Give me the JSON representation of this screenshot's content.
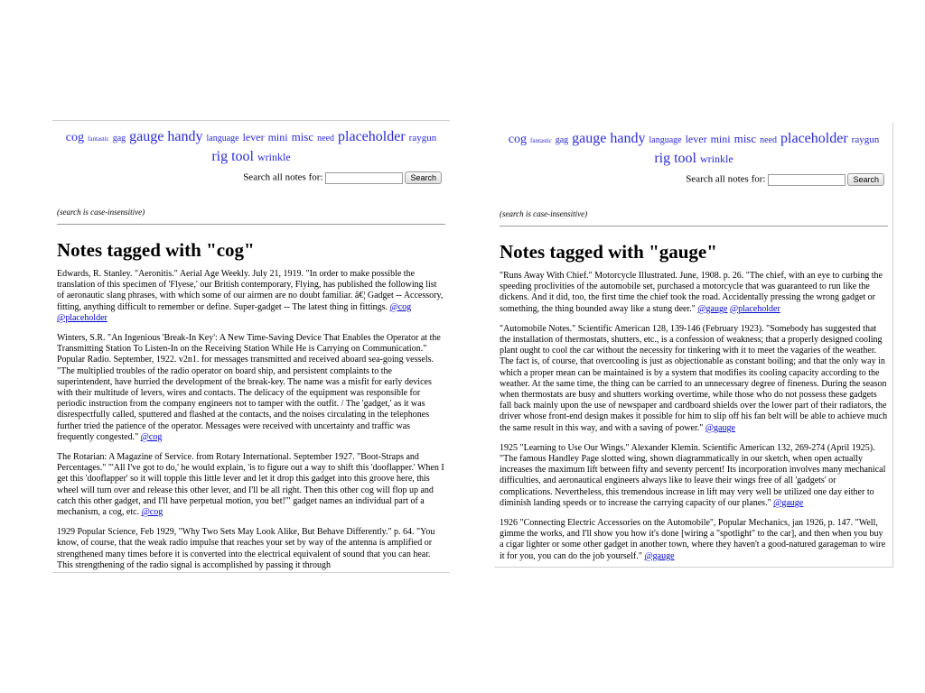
{
  "tags": [
    {
      "label": "cog",
      "size": 14
    },
    {
      "label": "fantastic",
      "size": 7
    },
    {
      "label": "gag",
      "size": 10
    },
    {
      "label": "gauge",
      "size": 16
    },
    {
      "label": "handy",
      "size": 16
    },
    {
      "label": "language",
      "size": 10
    },
    {
      "label": "lever",
      "size": 12
    },
    {
      "label": "mini",
      "size": 12
    },
    {
      "label": "misc",
      "size": 13
    },
    {
      "label": "need",
      "size": 10
    },
    {
      "label": "placeholder",
      "size": 16
    },
    {
      "label": "raygun",
      "size": 11
    },
    {
      "label": "rig",
      "size": 16
    },
    {
      "label": "tool",
      "size": 16
    },
    {
      "label": "wrinkle",
      "size": 12
    }
  ],
  "search": {
    "label": "Search all notes for:",
    "value": "",
    "button": "Search",
    "hint": "(search is case-insensitive)"
  },
  "left_pane": {
    "heading": "Notes tagged with \"cog\"",
    "notes": [
      {
        "text": "Edwards, R. Stanley. \"Aeronitis.\" Aerial Age Weekly. July 21, 1919. \"In order to make possible the translation of this specimen of 'Flyese,' our British contemporary, Flying, has published the following list of aeronautic slang phrases, with which some of our airmen are no doubt familiar. â€¦ Gadget -- Accessory, fitting, anything difficult to remember or define. Super-gadget -- The latest thing in fittings. ",
        "tags": [
          "@cog",
          "@placeholder"
        ]
      },
      {
        "text": "Winters, S.R. \"An Ingenious 'Break-In Key': A New Time-Saving Device That Enables the Operator at the Transmitting Station To Listen-In on the Receiving Station While He is Carrying on Communication.\" Popular Radio. September, 1922. v2n1. for messages transmitted and received aboard sea-going vessels. \"The multiplied troubles of the radio operator on board ship, and persistent complaints to the superintendent, have hurried the development of the break-key. The name was a misfit for early devices with their multitude of levers, wires and contacts. The delicacy of the equipment was responsible for periodic instruction from the company engineers not to tamper with the outfit. / The 'gadget,' as it was disrespectfully called, sputtered and flashed at the contacts, and the noises circulating in the telephones further tried the patience of the operator. Messages were received with uncertainty and traffic was frequently congested.\" ",
        "tags": [
          "@cog"
        ]
      },
      {
        "text": "The Rotarian: A Magazine of Service. from Rotary International. September 1927. \"Boot-Straps and Percentages.\" \"'All I've got to do,' he would explain, 'is to figure out a way to shift this 'dooflapper.' When I get this 'dooflapper' so it will topple this little lever and let it drop this gadget into this groove here, this wheel will turn over and release this other lever, and I'll be all right. Then this other cog will flop up and catch this other gadget, and I'll have perpetual motion, you bet!'\" gadget names an individual part of a mechanism, a cog, etc. ",
        "tags": [
          "@cog"
        ]
      },
      {
        "text": "1929 Popular Science, Feb 1929, \"Why Two Sets May Look Alike, But Behave Differently.\" p. 64. \"You know, of course, that the weak radio impulse that reaches your set by way of the antenna is amplified or strengthened many times before it is converted into the electrical equivalent of sound that you can hear. This strengthening of the radio signal is accomplished by passing it through",
        "tags": []
      }
    ]
  },
  "right_pane": {
    "heading": "Notes tagged with \"gauge\"",
    "notes": [
      {
        "text": "\"Runs Away With Chief.\" Motorcycle Illustrated. June, 1908. p. 26. \"The chief, with an eye to curbing the speeding proclivities of the automobile set, purchased a motorcycle that was guaranteed to run like the dickens. And it did, too, the first time the chief took the road. Accidentally pressing the wrong gadget or something, the thing bounded away like a stung deer.\" ",
        "tags": [
          "@gauge",
          "@placeholder"
        ]
      },
      {
        "text": "\"Automobile Notes.\" Scientific American 128, 139-146 (February 1923). \"Somebody has suggested that the installation of thermostats, shutters, etc., is a confession of weakness; that a properly designed cooling plant ought to cool the car without the necessity for tinkering with it to meet the vagaries of the weather. The fact is, of course, that overcooling is just as objectionable as constant boiling; and that the only way in which a proper mean can be maintained is by a system that modifies its cooling capacity according to the weather. At the same time, the thing can be carried to an unnecessary degree of fineness. During the season when thermostats are busy and shutters working overtime, while those who do not possess these gadgets fall back mainly upon the use of newspaper and cardboard shields over the lower part of their radiators, the driver whose front-end design makes it possible for him to slip off his fan belt will be able to achieve much the same result in this way, and with a saving of power.\" ",
        "tags": [
          "@gauge"
        ]
      },
      {
        "text": "1925 \"Learning to Use Our Wings.\" Alexander Klemin. Scientific American 132, 269-274 (April 1925). \"The famous Handley Page slotted wing, shown diagrammatically in our sketch, when open actually increases the maximum lift between fifty and seventy percent! Its incorporation involves many mechanical difficulties, and aeronautical engineers always like to leave their wings free of all 'gadgets' or complications. Nevertheless, this tremendous increase in lift may very well be utilized one day either to diminish landing speeds or to increase the carrying capacity of our planes.\" ",
        "tags": [
          "@gauge"
        ]
      },
      {
        "text": "1926 \"Connecting Electric Accessories on the Automobile\", Popular Mechanics, jan 1926, p. 147. \"Well, gimme the works, and I'll show you how it's done [wiring a \"spotlight\" to the car], and then when you buy a cigar lighter or some other gadget in another town, where they haven't a good-natured garageman to wire it for you, you can do the job yourself.\" ",
        "tags": [
          "@gauge"
        ]
      }
    ]
  }
}
